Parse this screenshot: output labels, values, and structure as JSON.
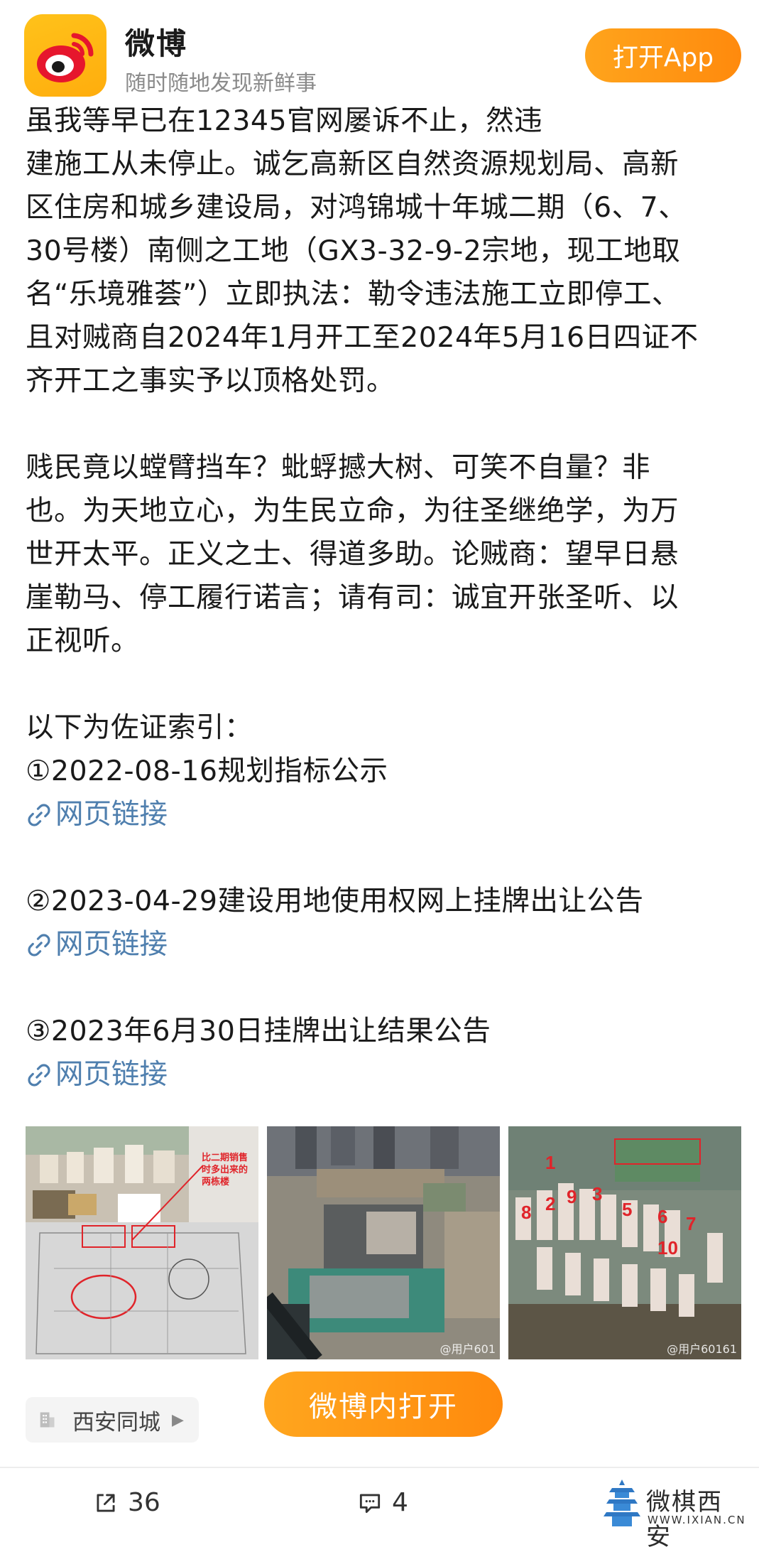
{
  "header": {
    "app_name": "微博",
    "slogan": "随时随地发现新鲜事",
    "open_app_label": "打开App"
  },
  "post": {
    "paragraphs": [
      [
        "虽我等早已在12345官网屡诉不止，然违",
        "建施工从未停止。诚乞高新区自然资源规划局、高新",
        "区住房和城乡建设局，对鸿锦城十年城二期（6、7、",
        "30号楼）南侧之工地（GX3-32-9-2宗地，现工地取",
        "名“乐境雅荟”）立即执法：勒令违法施工立即停工、",
        "且对贼商自2024年1月开工至2024年5月16日四证不",
        "齐开工之事实予以顶格处罚。"
      ],
      [
        "贱民竟以螳臂挡车？蚍蜉撼大树、可笑不自量？非",
        "也。为天地立心，为生民立命，为往圣继绝学，为万",
        "世开太平。正义之士、得道多助。论贼商：望早日悬",
        "崖勒马、停工履行诺言；请有司：诚宜开张圣听、以",
        "正视听。"
      ]
    ],
    "evidence_intro": "以下为佐证索引：",
    "evidence": [
      {
        "title": "①2022-08-16规划指标公示",
        "link_label": "网页链接"
      },
      {
        "title": "②2023-04-29建设用地使用权网上挂牌出让公告",
        "link_label": "网页链接"
      },
      {
        "title": "③2023年6月30日挂牌出让结果公告",
        "link_label": "网页链接"
      }
    ],
    "images": {
      "note_1": "比二期销售时多出来的两栋楼",
      "watermark_2": "@用户601",
      "watermark_3": "@用户60161"
    }
  },
  "location": {
    "label": "西安同城"
  },
  "open_in_weibo_label": "微博内打开",
  "actions": {
    "repost_count": "36",
    "comment_count": "4"
  },
  "watermark": {
    "text": "微棋西安",
    "url": "WWW.IXIAN.CN"
  },
  "colors": {
    "accent_orange": "#ff8a0d",
    "link_blue": "#4f7fae",
    "logo_yellow": "#ffb514"
  }
}
